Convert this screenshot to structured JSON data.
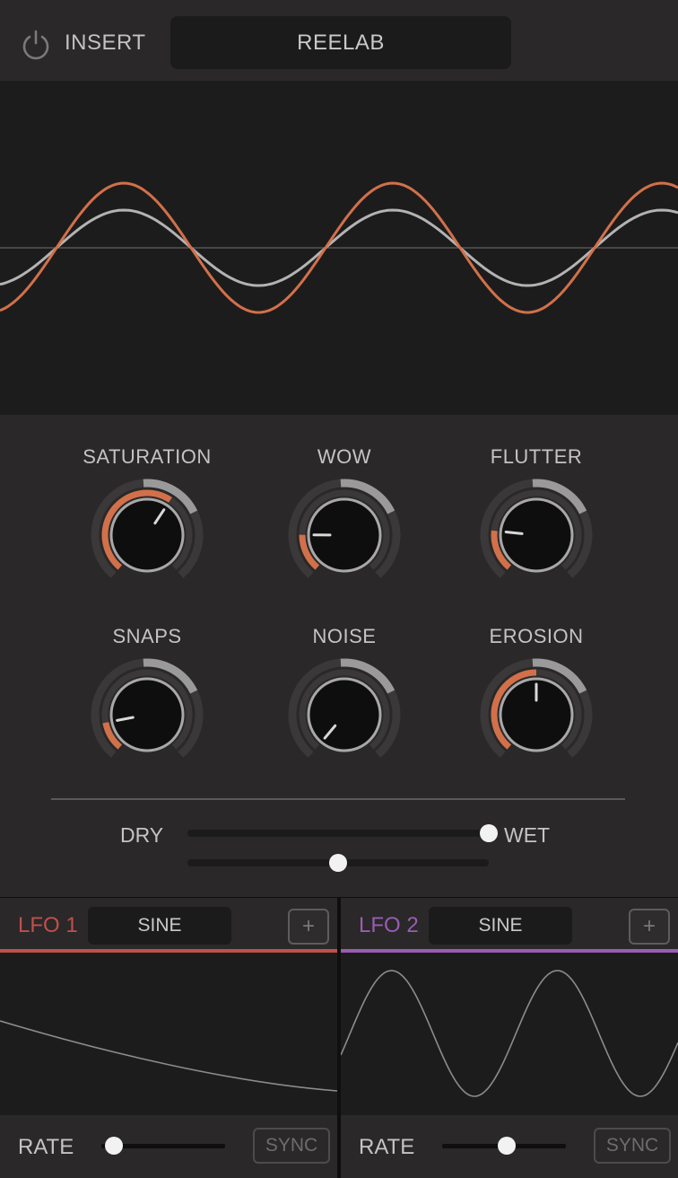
{
  "header": {
    "power_icon": "power-icon",
    "mode_label": "INSERT",
    "preset_name": "REELAB"
  },
  "waveform": {
    "colors": {
      "processed": "#d2704a",
      "dry": "#b3b3b3",
      "zero_line": "#5a5858"
    }
  },
  "knobs": [
    {
      "name": "SATURATION",
      "value": 0.62
    },
    {
      "name": "WOW",
      "value": 0.18
    },
    {
      "name": "FLUTTER",
      "value": 0.2
    },
    {
      "name": "SNAPS",
      "value": 0.14
    },
    {
      "name": "NOISE",
      "value": 0.0
    },
    {
      "name": "EROSION",
      "value": 0.5
    }
  ],
  "mix": {
    "dry_label": "DRY",
    "wet_label": "WET",
    "mix_value": 1.0,
    "secondary_value": 0.5
  },
  "lfo1": {
    "title": "LFO 1",
    "waveform": "SINE",
    "add_label": "+",
    "rate_label": "RATE",
    "rate_value": 0.1,
    "sync_label": "SYNC",
    "color": "#c0504d"
  },
  "lfo2": {
    "title": "LFO 2",
    "waveform": "SINE",
    "add_label": "+",
    "rate_label": "RATE",
    "rate_value": 0.52,
    "sync_label": "SYNC",
    "color": "#9a5cb4"
  },
  "colors": {
    "accent": "#d2704a",
    "knob_arc": "#9a9a9a",
    "knob_track": "#3a3838"
  }
}
